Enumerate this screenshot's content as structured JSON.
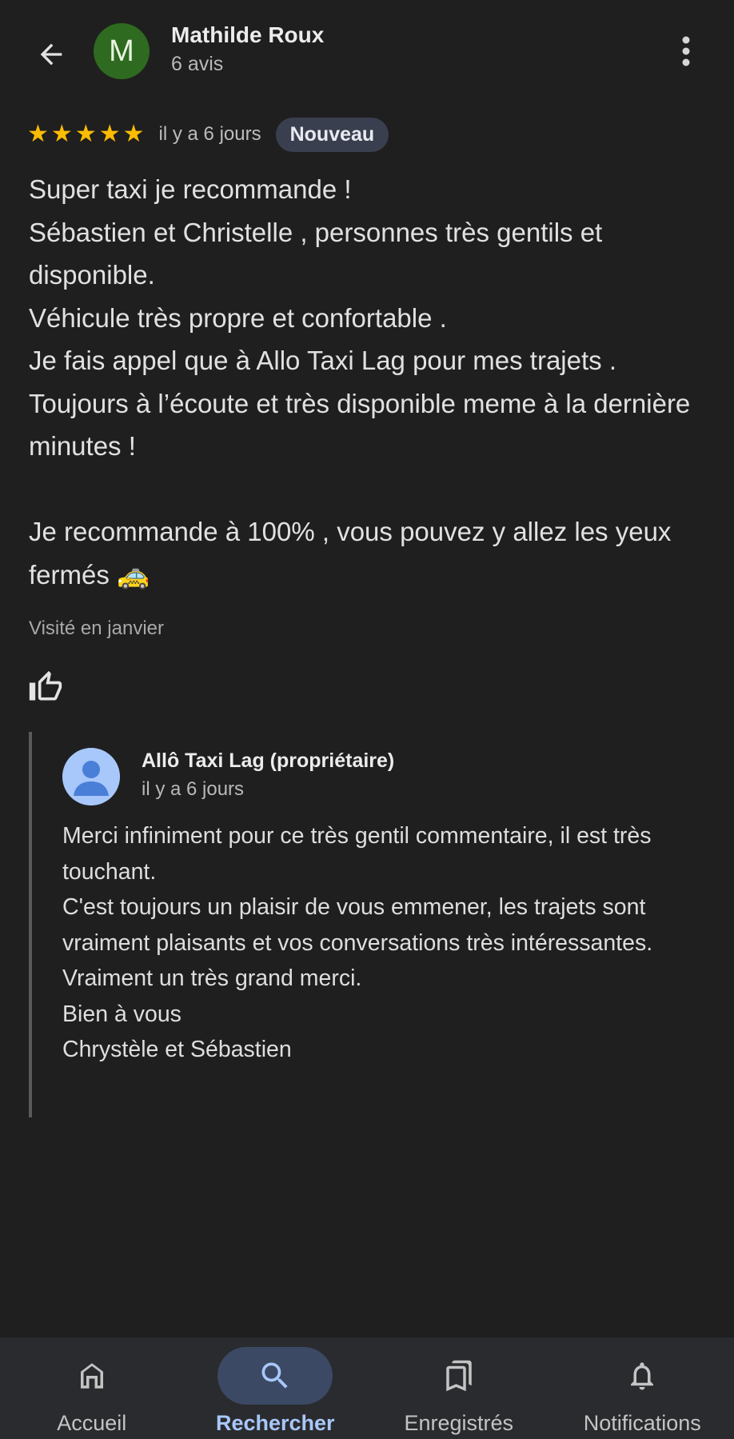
{
  "header": {
    "avatar_letter": "M",
    "reviewer_name": "Mathilde Roux",
    "review_count": "6 avis"
  },
  "review": {
    "rating": 5,
    "stars": [
      "★",
      "★",
      "★",
      "★",
      "★"
    ],
    "date": "il y a 6 jours",
    "badge": "Nouveau",
    "text": "Super taxi je recommande !\nSébastien et Christelle , personnes très gentils et disponible.\nVéhicule très propre et confortable .\nJe fais appel que à Allo Taxi Lag pour mes trajets .\nToujours à l’écoute et très disponible meme à la dernière minutes !\n\nJe recommande à 100% , vous pouvez y allez les yeux fermés 🚕",
    "visited": "Visité en janvier"
  },
  "owner_response": {
    "name": "Allô Taxi Lag (propriétaire)",
    "date": "il y a 6 jours",
    "text": "Merci infiniment pour ce très gentil commentaire, il est très touchant.\nC'est toujours un plaisir de vous emmener, les trajets sont vraiment plaisants et vos conversations très intéressantes.\nVraiment un très grand merci.\nBien à vous\nChrystèle et Sébastien"
  },
  "bottom_nav": {
    "items": [
      {
        "label": "Accueil",
        "icon": "home-icon",
        "active": false
      },
      {
        "label": "Rechercher",
        "icon": "search-icon",
        "active": true
      },
      {
        "label": "Enregistrés",
        "icon": "bookmarks-icon",
        "active": false
      },
      {
        "label": "Notifications",
        "icon": "bell-icon",
        "active": false
      }
    ]
  },
  "colors": {
    "background": "#1f1f1f",
    "star": "#fbbc04",
    "accent": "#a8c7fa",
    "avatar_green": "#2e6a1f"
  }
}
